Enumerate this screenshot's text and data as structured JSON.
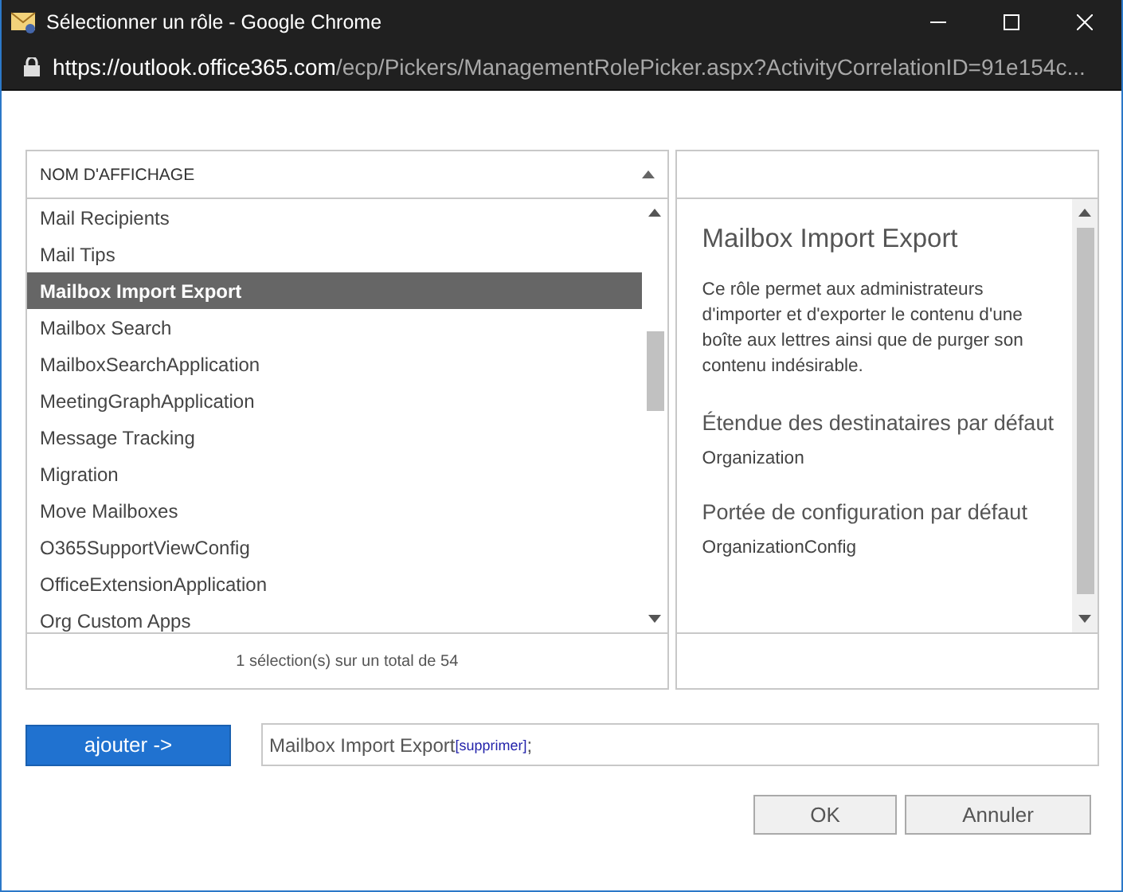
{
  "window": {
    "title": "Sélectionner un rôle - Google Chrome",
    "url_host": "https://outlook.office365.com",
    "url_path": "/ecp/Pickers/ManagementRolePicker.aspx?ActivityCorrelationID=91e154c..."
  },
  "list": {
    "column": "NOM D'AFFICHAGE",
    "items": [
      {
        "label": "Mail Recipients",
        "selected": false
      },
      {
        "label": "Mail Tips",
        "selected": false
      },
      {
        "label": "Mailbox Import Export",
        "selected": true
      },
      {
        "label": "Mailbox Search",
        "selected": false
      },
      {
        "label": "MailboxSearchApplication",
        "selected": false
      },
      {
        "label": "MeetingGraphApplication",
        "selected": false
      },
      {
        "label": "Message Tracking",
        "selected": false
      },
      {
        "label": "Migration",
        "selected": false
      },
      {
        "label": "Move Mailboxes",
        "selected": false
      },
      {
        "label": "O365SupportViewConfig",
        "selected": false
      },
      {
        "label": "OfficeExtensionApplication",
        "selected": false
      },
      {
        "label": "Org Custom Apps",
        "selected": false
      }
    ],
    "footer": "1 sélection(s) sur un total de 54"
  },
  "details": {
    "title": "Mailbox Import Export",
    "description": "Ce rôle permet aux administrateurs d'importer et d'exporter le contenu d'une boîte aux lettres ainsi que de purger son contenu indésirable.",
    "sections": [
      {
        "heading": "Étendue des destinataires par défaut",
        "value": "Organization"
      },
      {
        "heading": "Portée de configuration par défaut",
        "value": "OrganizationConfig"
      }
    ]
  },
  "add_button": "ajouter ->",
  "selection": {
    "name": "Mailbox Import Export",
    "remove_link": "[supprimer]",
    "separator": ";"
  },
  "buttons": [
    "OK",
    "Annuler"
  ]
}
